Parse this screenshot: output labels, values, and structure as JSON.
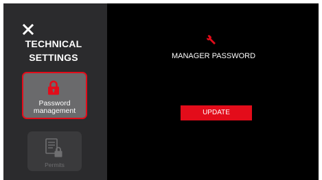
{
  "colors": {
    "accent": "#e30c1a",
    "sidebar_background": "#2b2b2d",
    "main_background": "#000000",
    "active_tile_background": "#6a6a6c",
    "disabled_tile_background": "#3a3a3c"
  },
  "sidebar": {
    "close_icon": "close-icon",
    "title_line1": "TECHNICAL",
    "title_line2": "SETTINGS",
    "items": [
      {
        "label_line1": "Password",
        "label_line2": "management",
        "icon": "lock-icon",
        "state": "active"
      },
      {
        "label": "Permits",
        "icon": "document-lock-icon",
        "state": "disabled"
      }
    ]
  },
  "main": {
    "icon": "wrench-icon",
    "title": "MANAGER PASSWORD",
    "update_button_label": "UPDATE"
  }
}
